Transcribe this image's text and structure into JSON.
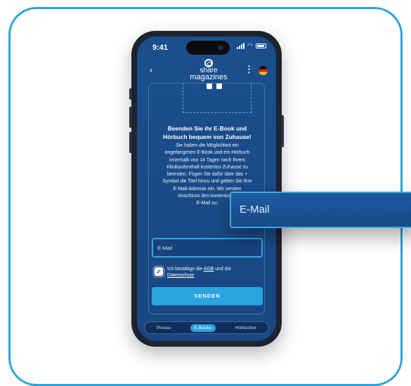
{
  "status": {
    "time": "9:41"
  },
  "header": {
    "logo_line1": "share",
    "logo_line2": "magazines",
    "back_icon": "‹",
    "menu_icon": "⋮"
  },
  "content": {
    "headline_line1": "Beenden Sie ihr E-Book und",
    "headline_line2": "Hörbuch bequem von Zuhause!",
    "body_lines": [
      "Sie haben die Möglichkeit ein",
      "angefangenes E-Book und ein Hörbuch",
      "innerhalb von 14 Tagen nach Ihrem",
      "Klinikaufenthalt kostenlos Zuhause zu",
      "beenden. Fügen Sie dafür über das +",
      "Symbol die Titel hinzu und geben Sie Ihre",
      "E-Mail-Adresse ein. Wir senden",
      "Anschluss den kostenlosen",
      "E-Mail zu."
    ],
    "email_placeholder": "E-Mail",
    "consent_prefix": "Ich bestätige die ",
    "consent_agb": "AGB",
    "consent_middle": " und die",
    "consent_privacy": "Datenschutz",
    "send_label": "SENDEN"
  },
  "tabs": [
    {
      "label": "Presse",
      "active": false
    },
    {
      "label": "E-Books",
      "active": true
    },
    {
      "label": "Hörbücher",
      "active": false
    }
  ],
  "callout": {
    "text": "E-Mail"
  },
  "colors": {
    "accent": "#2aa3df",
    "screen_bg": "#1a4b88",
    "frame": "#2aa3df"
  }
}
